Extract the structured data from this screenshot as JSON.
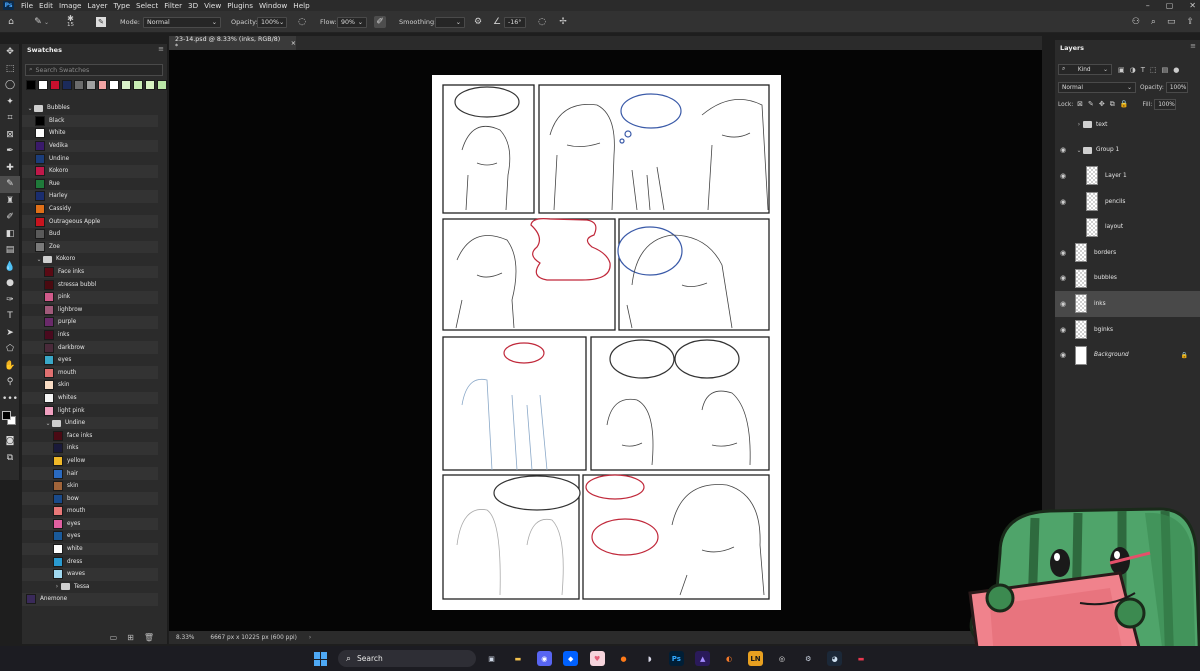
{
  "app": {
    "logo": "Ps",
    "menus": [
      "File",
      "Edit",
      "Image",
      "Layer",
      "Type",
      "Select",
      "Filter",
      "3D",
      "View",
      "Plugins",
      "Window",
      "Help"
    ]
  },
  "options": {
    "brush_size": "15",
    "mode_label": "Mode:",
    "mode_value": "Normal",
    "opacity_label": "Opacity:",
    "opacity_value": "100%",
    "flow_label": "Flow:",
    "flow_value": "90%",
    "smoothing_label": "Smoothing:",
    "smoothing_value": "",
    "angle_value": "-16°"
  },
  "swatches": {
    "title": "Swatches",
    "search_placeholder": "Search Swatches",
    "recent_colors": [
      "#000000",
      "#ffffff",
      "#c8102e",
      "#1b2a5a",
      "#6b6b6b",
      "#a0a0a0",
      "#f2a3a3",
      "#ffffff",
      "#d8f0c8",
      "#c8ecb4",
      "#d6f2c2",
      "#b9e6a6"
    ],
    "items": [
      {
        "type": "group",
        "name": "Bubbles",
        "open": true,
        "depth": 0
      },
      {
        "type": "swatch",
        "name": "Black",
        "color": "#000000",
        "depth": 1
      },
      {
        "type": "swatch",
        "name": "White",
        "color": "#ffffff",
        "depth": 1
      },
      {
        "type": "swatch",
        "name": "Vedika",
        "color": "#3a1a6a",
        "depth": 1
      },
      {
        "type": "swatch",
        "name": "Undine",
        "color": "#1b3d7a",
        "depth": 1
      },
      {
        "type": "swatch",
        "name": "Kokoro",
        "color": "#c0184a",
        "depth": 1
      },
      {
        "type": "swatch",
        "name": "Rue",
        "color": "#1f7a3a",
        "depth": 1
      },
      {
        "type": "swatch",
        "name": "Harley",
        "color": "#1a2d6e",
        "depth": 1
      },
      {
        "type": "swatch",
        "name": "Cassidy",
        "color": "#e07018",
        "depth": 1
      },
      {
        "type": "swatch",
        "name": "Outrageous Apple",
        "color": "#c8141e",
        "depth": 1
      },
      {
        "type": "swatch",
        "name": "Bud",
        "color": "#5a5a5a",
        "depth": 1
      },
      {
        "type": "swatch",
        "name": "Zoe",
        "color": "#7a7a7a",
        "depth": 1
      },
      {
        "type": "group",
        "name": "Kokoro",
        "open": true,
        "depth": 1
      },
      {
        "type": "swatch",
        "name": "Face inks",
        "color": "#5a0a14",
        "depth": 2
      },
      {
        "type": "swatch",
        "name": "stressa bubbl",
        "color": "#4a0a10",
        "depth": 2
      },
      {
        "type": "swatch",
        "name": "pink",
        "color": "#d05a8a",
        "depth": 2
      },
      {
        "type": "swatch",
        "name": "lighbrow",
        "color": "#a05a7a",
        "depth": 2
      },
      {
        "type": "swatch",
        "name": "purple",
        "color": "#6a2a6a",
        "depth": 2
      },
      {
        "type": "swatch",
        "name": "inks",
        "color": "#4a0a1e",
        "depth": 2
      },
      {
        "type": "swatch",
        "name": "darkbrow",
        "color": "#4a2a3a",
        "depth": 2
      },
      {
        "type": "swatch",
        "name": "eyes",
        "color": "#3aa8c8",
        "depth": 2
      },
      {
        "type": "swatch",
        "name": "mouth",
        "color": "#e07070",
        "depth": 2
      },
      {
        "type": "swatch",
        "name": "skin",
        "color": "#f8dcc4",
        "depth": 2
      },
      {
        "type": "swatch",
        "name": "whites",
        "color": "#f4f4f4",
        "depth": 2
      },
      {
        "type": "swatch",
        "name": "light pink",
        "color": "#f0a0c0",
        "depth": 2
      },
      {
        "type": "group",
        "name": "Undine",
        "open": true,
        "depth": 2
      },
      {
        "type": "swatch",
        "name": "face inks",
        "color": "#4a0a14",
        "depth": 3
      },
      {
        "type": "swatch",
        "name": "inks",
        "color": "#1a1a3a",
        "depth": 3
      },
      {
        "type": "swatch",
        "name": "yellow",
        "color": "#f0b828",
        "depth": 3
      },
      {
        "type": "swatch",
        "name": "hair",
        "color": "#2a6ac0",
        "depth": 3
      },
      {
        "type": "swatch",
        "name": "skin",
        "color": "#a0643a",
        "depth": 3
      },
      {
        "type": "swatch",
        "name": "bow",
        "color": "#1a4a8a",
        "depth": 3
      },
      {
        "type": "swatch",
        "name": "mouth",
        "color": "#e87878",
        "depth": 3
      },
      {
        "type": "swatch",
        "name": "eyes",
        "color": "#e060a0",
        "depth": 3
      },
      {
        "type": "swatch",
        "name": "eyes",
        "color": "#1a5a9a",
        "depth": 3
      },
      {
        "type": "swatch",
        "name": "white",
        "color": "#ffffff",
        "depth": 3
      },
      {
        "type": "swatch",
        "name": "dress",
        "color": "#2a9ad0",
        "depth": 3
      },
      {
        "type": "swatch",
        "name": "waves",
        "color": "#a0d8f0",
        "depth": 3
      },
      {
        "type": "group",
        "name": "Tessa",
        "open": false,
        "depth": 3
      },
      {
        "type": "swatch",
        "name": "Anemone",
        "color": "#3a2a5a",
        "depth": 0
      }
    ]
  },
  "document": {
    "tab_title": "23-14.psd @ 8.33% (inks, RGB/8) *",
    "close_glyph": "×",
    "zoom": "8.33%",
    "doc_info": "6667 px x 10225 px (600 ppi)"
  },
  "layers": {
    "title": "Layers",
    "filter_value": "Kind",
    "blend_mode": "Normal",
    "opacity_label": "Opacity:",
    "opacity_value": "100%",
    "lock_label": "Lock:",
    "fill_label": "Fill:",
    "fill_value": "100%",
    "items": [
      {
        "name": "text",
        "kind": "group",
        "visible": false,
        "open": false,
        "depth": 0
      },
      {
        "name": "Group 1",
        "kind": "group",
        "visible": true,
        "open": true,
        "depth": 0
      },
      {
        "name": "Layer 1",
        "kind": "layer",
        "visible": true,
        "depth": 1
      },
      {
        "name": "pencils",
        "kind": "layer",
        "visible": true,
        "depth": 1
      },
      {
        "name": "layout",
        "kind": "layer",
        "visible": false,
        "depth": 1
      },
      {
        "name": "borders",
        "kind": "layer",
        "visible": true,
        "depth": 0
      },
      {
        "name": "bubbles",
        "kind": "layer",
        "visible": true,
        "depth": 0
      },
      {
        "name": "inks",
        "kind": "layer",
        "visible": true,
        "depth": 0,
        "selected": true
      },
      {
        "name": "bginks",
        "kind": "layer",
        "visible": true,
        "depth": 0
      },
      {
        "name": "Background",
        "kind": "background",
        "visible": true,
        "depth": 0,
        "locked": true
      }
    ]
  },
  "taskbar": {
    "search_label": "Search",
    "apps": [
      {
        "name": "task-view",
        "glyph": "▣",
        "color": "#cfd8e6",
        "bg": "transparent"
      },
      {
        "name": "file-explorer",
        "glyph": "▬",
        "color": "#f2c14e",
        "bg": "transparent"
      },
      {
        "name": "discord",
        "glyph": "◉",
        "color": "#ffffff",
        "bg": "#5865f2"
      },
      {
        "name": "dropbox",
        "glyph": "◆",
        "color": "#ffffff",
        "bg": "#0061fe"
      },
      {
        "name": "app-pink",
        "glyph": "♥",
        "color": "#e4607a",
        "bg": "#f6d4dc"
      },
      {
        "name": "firefox",
        "glyph": "●",
        "color": "#ff7a18",
        "bg": "transparent"
      },
      {
        "name": "app-shield",
        "glyph": "◗",
        "color": "#d8d8e8",
        "bg": "transparent"
      },
      {
        "name": "photoshop",
        "glyph": "Ps",
        "color": "#31a8ff",
        "bg": "#001e36"
      },
      {
        "name": "app-purple",
        "glyph": "▲",
        "color": "#a48cff",
        "bg": "#2a1a5a"
      },
      {
        "name": "blender",
        "glyph": "◐",
        "color": "#f5792a",
        "bg": "transparent"
      },
      {
        "name": "ln-app",
        "glyph": "LN",
        "color": "#1a1a1a",
        "bg": "#e8a020"
      },
      {
        "name": "obs",
        "glyph": "◎",
        "color": "#e8e8e8",
        "bg": "transparent"
      },
      {
        "name": "settings",
        "glyph": "⚙",
        "color": "#cfd8e6",
        "bg": "transparent"
      },
      {
        "name": "steam",
        "glyph": "◕",
        "color": "#cfe0f0",
        "bg": "#1b2838"
      },
      {
        "name": "app-red",
        "glyph": "▬",
        "color": "#e8384f",
        "bg": "transparent"
      }
    ]
  }
}
